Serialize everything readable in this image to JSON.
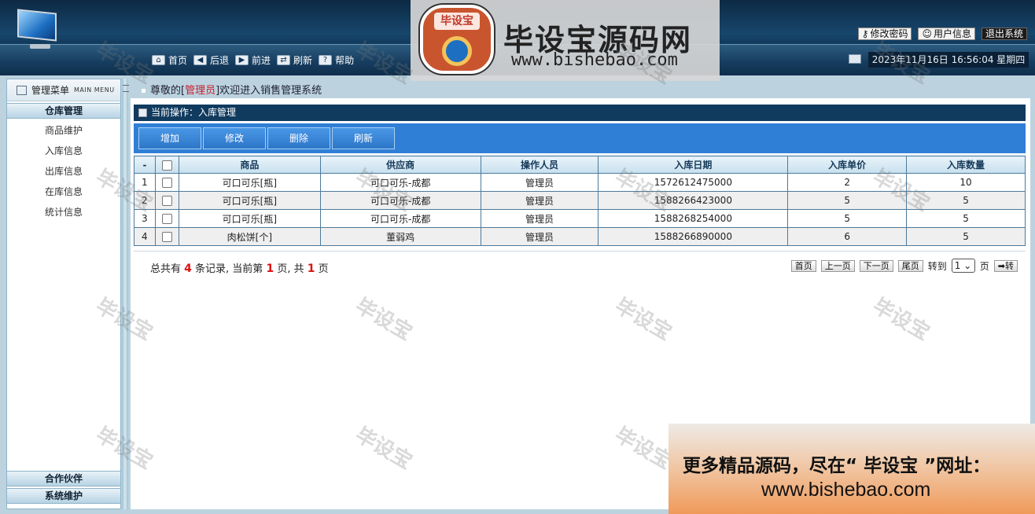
{
  "header": {
    "banner_title": "毕设宝源码网",
    "banner_url": "www.bishebao.com",
    "badge_text": "毕设宝",
    "nav": [
      {
        "label": "首页",
        "icon": "home-icon"
      },
      {
        "label": "后退",
        "icon": "back-arrow-icon"
      },
      {
        "label": "前进",
        "icon": "forward-arrow-icon"
      },
      {
        "label": "刷新",
        "icon": "refresh-icon"
      },
      {
        "label": "帮助",
        "icon": "help-icon"
      }
    ],
    "top_links": [
      "修改密码",
      "用户信息",
      "退出系统"
    ],
    "datetime": "2023年11月16日 16:56:04 星期四"
  },
  "sidebar": {
    "title": "管理菜单",
    "subtitle": "MAIN MENU",
    "groups": [
      {
        "label": "仓库管理",
        "items": [
          "商品维护",
          "入库信息",
          "出库信息",
          "在库信息",
          "统计信息"
        ]
      },
      {
        "label": "合作伙伴"
      },
      {
        "label": "系统维护"
      }
    ]
  },
  "welcome": {
    "prefix": "尊敬的[",
    "role": "管理员",
    "suffix": "]欢迎进入销售管理系统"
  },
  "main": {
    "current_op": "当前操作：入库管理",
    "toolbar": [
      "增加",
      "修改",
      "删除",
      "刷新"
    ],
    "table": {
      "columns": [
        "-",
        "",
        "商品",
        "供应商",
        "操作人员",
        "入库日期",
        "入库单价",
        "入库数量"
      ],
      "rows": [
        [
          "1",
          "",
          "可口可乐[瓶]",
          "可口可乐-成都",
          "管理员",
          "1572612475000",
          "2",
          "10"
        ],
        [
          "2",
          "",
          "可口可乐[瓶]",
          "可口可乐-成都",
          "管理员",
          "1588266423000",
          "5",
          "5"
        ],
        [
          "3",
          "",
          "可口可乐[瓶]",
          "可口可乐-成都",
          "管理员",
          "1588268254000",
          "5",
          "5"
        ],
        [
          "4",
          "",
          "肉松饼[个]",
          "董弱鸡",
          "管理员",
          "1588266890000",
          "6",
          "5"
        ]
      ]
    },
    "pager": {
      "t1": "总共有",
      "total": "4",
      "t2": "条记录, 当前第",
      "current": "1",
      "t3": "页, 共",
      "pages": "1",
      "t4": "页",
      "buttons": [
        "首页",
        "上一页",
        "下一页",
        "尾页"
      ],
      "goto_label": "转到",
      "page_select": "1",
      "page_unit": "页",
      "go_button": "➡转"
    }
  },
  "watermark": "毕设宝",
  "promo": {
    "line1": "更多精品源码，尽在“ 毕设宝 ”网址：",
    "line2": "www.bishebao.com"
  }
}
